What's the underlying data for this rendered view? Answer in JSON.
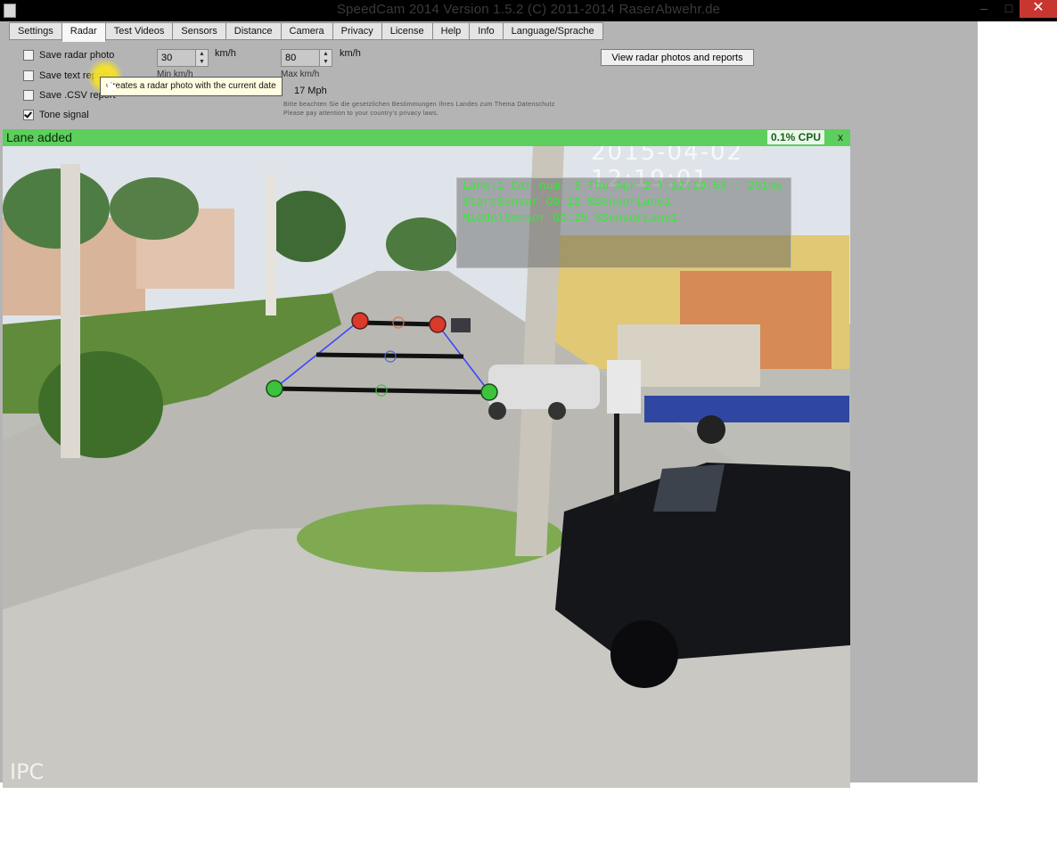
{
  "window": {
    "title": "SpeedCam 2014 Version 1.5.2 (C) 2011-2014 RaserAbwehr.de",
    "close_glyph": "✕",
    "min_glyph": "–",
    "max_glyph": "□"
  },
  "tabs": [
    {
      "label": "Settings"
    },
    {
      "label": "Radar"
    },
    {
      "label": "Test Videos"
    },
    {
      "label": "Sensors"
    },
    {
      "label": "Distance"
    },
    {
      "label": "Camera"
    },
    {
      "label": "Privacy"
    },
    {
      "label": "License"
    },
    {
      "label": "Help"
    },
    {
      "label": "Info"
    },
    {
      "label": "Language/Sprache"
    }
  ],
  "active_tab": "Radar",
  "options": {
    "save_radar_photo": {
      "label": "Save radar photo",
      "checked": false
    },
    "save_text_report": {
      "label": "Save text report",
      "checked": false
    },
    "save_csv_report": {
      "label": "Save .CSV report",
      "checked": false
    },
    "tone_signal": {
      "label": "Tone signal",
      "checked": true
    }
  },
  "speed": {
    "min_value": "30",
    "max_value": "80",
    "unit": "km/h",
    "min_label": "Min km/h",
    "max_label": "Max km/h",
    "mph_text": "17 Mph"
  },
  "privacy_note": {
    "line1": "Bitte beachten Sie die gesetzlichen Bestimmungen Ihres Landes zum Thema Datenschutz",
    "line2": "Please pay attention to your country's privacy laws."
  },
  "view_button": {
    "label": "View radar photos and reports"
  },
  "tooltip": {
    "text": "Creates a radar photo with the current date"
  },
  "status": {
    "message": "Lane added",
    "cpu": "0.1% CPU",
    "close_glyph": "x"
  },
  "camera": {
    "timestamp": "2015-04-02 12:19:01",
    "watermark": "IPC",
    "overlay": {
      "line1": "Lane:1 Car num: 3 Thu Apr 2  T:12:19:53 : 291ms",
      "line2": "StartSensor GO:12 %SensorLane1",
      "line3": "MiddelSensor GO:25 %SensorLane1"
    }
  },
  "colors": {
    "status_green": "#5ccf5c",
    "overlay_text": "#39e639",
    "close_red": "#c7372f",
    "sensor_red": "#d93a2a",
    "sensor_green": "#3cc23c"
  }
}
